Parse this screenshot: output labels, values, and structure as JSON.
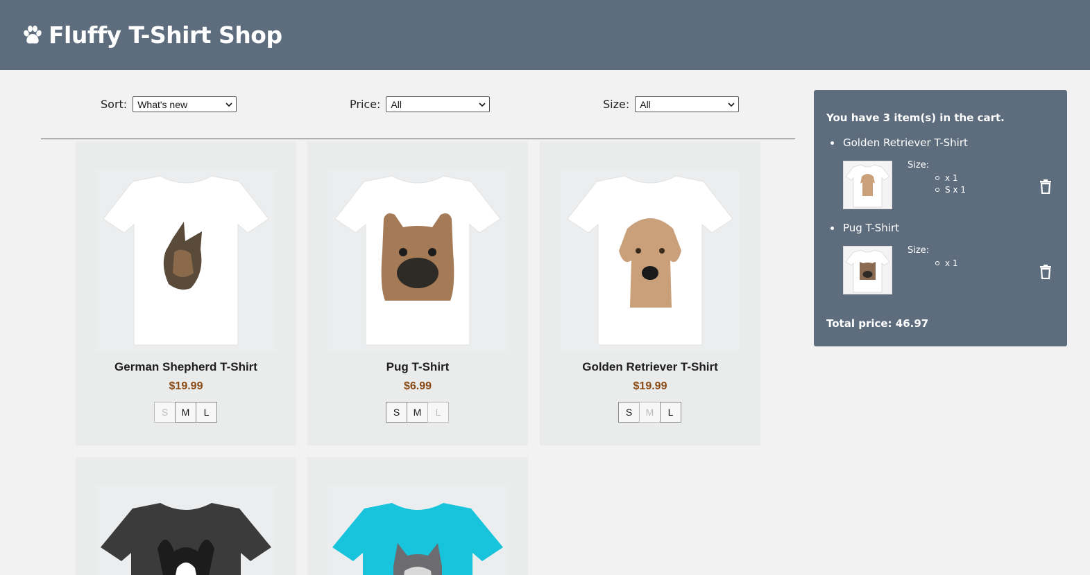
{
  "header": {
    "title": "Fluffy T-Shirt Shop",
    "icon": "paw-icon"
  },
  "filters": {
    "sort": {
      "label": "Sort:",
      "value": "What's new"
    },
    "price": {
      "label": "Price:",
      "value": "All"
    },
    "size": {
      "label": "Size:",
      "value": "All"
    }
  },
  "products": [
    {
      "name": "German Shepherd T-Shirt",
      "price": "$19.99",
      "shirt_color": "#ffffff",
      "sizes": [
        {
          "label": "S",
          "available": false
        },
        {
          "label": "M",
          "available": true
        },
        {
          "label": "L",
          "available": true
        }
      ]
    },
    {
      "name": "Pug T-Shirt",
      "price": "$6.99",
      "shirt_color": "#ffffff",
      "sizes": [
        {
          "label": "S",
          "available": true
        },
        {
          "label": "M",
          "available": true
        },
        {
          "label": "L",
          "available": false
        }
      ]
    },
    {
      "name": "Golden Retriever T-Shirt",
      "price": "$19.99",
      "shirt_color": "#ffffff",
      "sizes": [
        {
          "label": "S",
          "available": true
        },
        {
          "label": "M",
          "available": false
        },
        {
          "label": "L",
          "available": true
        }
      ]
    },
    {
      "shirt_color": "#3b3b3b"
    },
    {
      "shirt_color": "#17c4dc"
    }
  ],
  "cart": {
    "count_text": "You have 3 item(s) in the cart.",
    "items": [
      {
        "name": "Golden Retriever T-Shirt",
        "size_label": "Size:",
        "sizes": [
          "x 1",
          "S x 1"
        ]
      },
      {
        "name": "Pug T-Shirt",
        "size_label": "Size:",
        "sizes": [
          "x 1"
        ]
      }
    ],
    "total_text": "Total price: 46.97"
  },
  "colors": {
    "header_bg": "#5d6d7e",
    "price": "#8b4a14",
    "page_bg": "#f1f2f1"
  }
}
